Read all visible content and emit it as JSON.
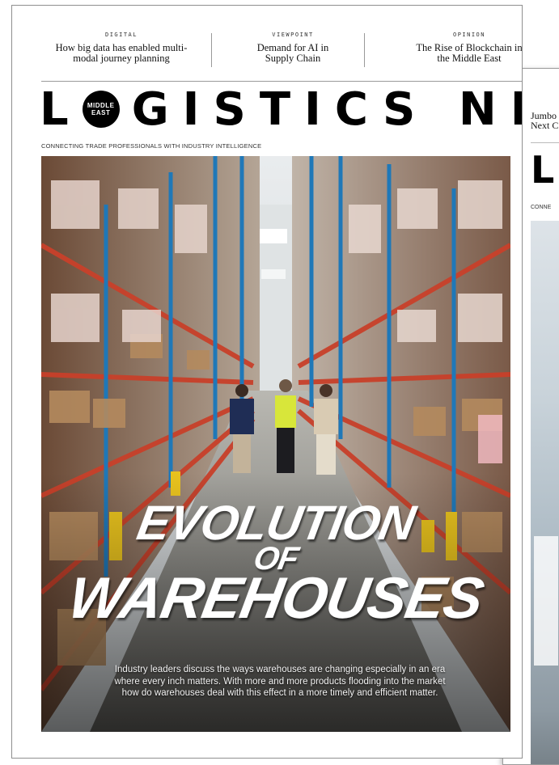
{
  "front_cover": {
    "teasers": [
      {
        "kicker": "DIGITAL",
        "headline_line1": "How big data has enabled multi-",
        "headline_line2": "modal journey planning"
      },
      {
        "kicker": "VIEWPOINT",
        "headline_line1": "Demand for AI in",
        "headline_line2": "Supply Chain"
      },
      {
        "kicker": "OPINION",
        "headline_line1": "The Rise of Blockchain in",
        "headline_line2": "the Middle East"
      }
    ],
    "logo": {
      "first_letter": "L",
      "badge_line1": "MIDDLE",
      "badge_line2": "EAST",
      "rest": "GISTICS NEWS"
    },
    "tagline": "CONNECTING TRADE PROFESSIONALS WITH INDUSTRY INTELLIGENCE",
    "cover_title": {
      "line1": "EVOLUTION",
      "line2": "OF",
      "line3": "WAREHOUSES"
    },
    "blurb_line1": "Industry leaders discuss the ways warehouses are changing especially in an era",
    "blurb_line2": "where every inch matters. With more and more products flooding into the market",
    "blurb_line3": "how do warehouses deal with this effect in a more timely and efficient matter."
  },
  "back_cover": {
    "teaser_line1": "Jumbo",
    "teaser_line2": "Next C",
    "logo_letter": "L",
    "tagline_fragment": "CONNE"
  },
  "colors": {
    "rack_orange": "#c8402a",
    "rack_blue": "#1f78b8",
    "vest_yellow": "#d8e63a",
    "floor": "#8a8a86"
  }
}
